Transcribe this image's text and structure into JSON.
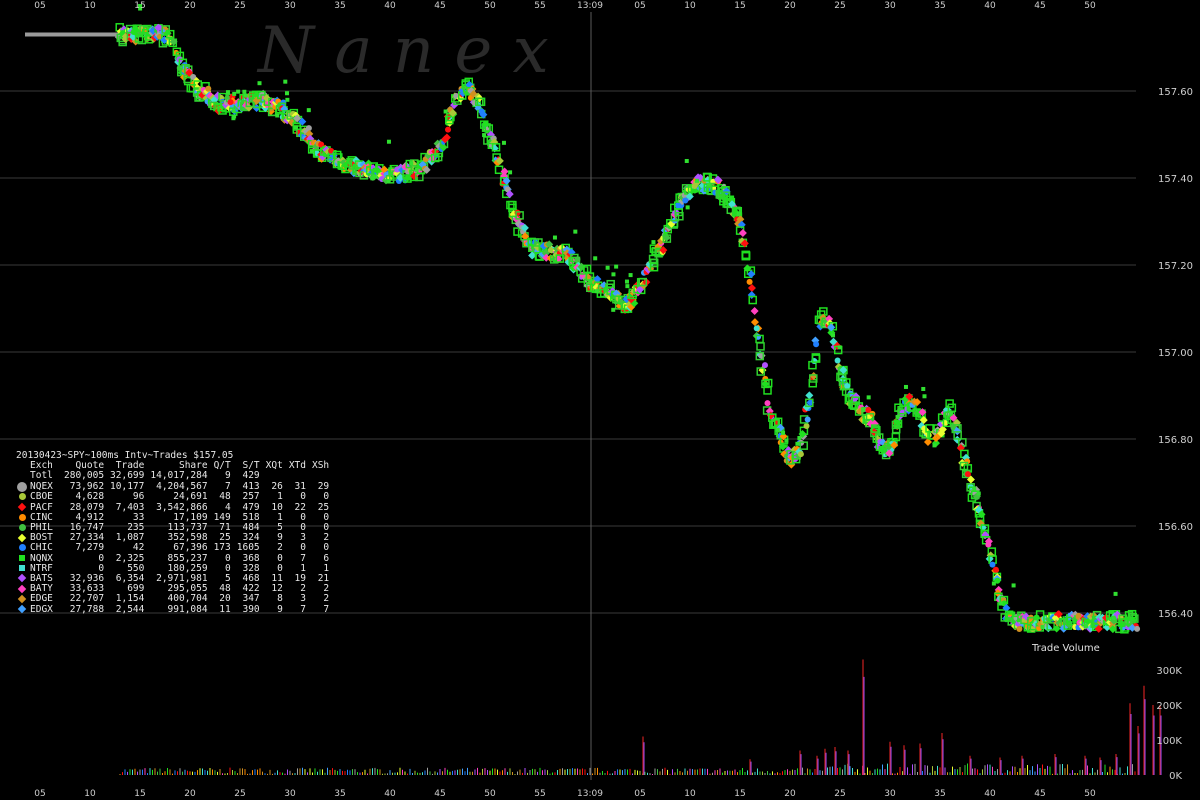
{
  "watermark": "N a n e x",
  "volume_label": "Trade Volume",
  "legend": {
    "title": "20130423~SPY~100ms Intv~Trades $157.05",
    "headers": [
      "Exch",
      "Quote",
      "Trade",
      "Share",
      "Q/T",
      "S/T",
      "XQt",
      "XTd",
      "XSh"
    ],
    "rows": [
      {
        "exch": "Totl",
        "quote": "280,005",
        "trade": "32,699",
        "share": "14,017,284",
        "qt": "9",
        "st": "429",
        "xqt": "",
        "xtd": "",
        "xsh": "",
        "color": "",
        "marker": "none"
      },
      {
        "exch": "NQEX",
        "quote": "73,962",
        "trade": "10,177",
        "share": "4,204,567",
        "qt": "7",
        "st": "413",
        "xqt": "26",
        "xtd": "31",
        "xsh": "29",
        "color": "#a0a0a0",
        "marker": "bigdot"
      },
      {
        "exch": "CBOE",
        "quote": "4,628",
        "trade": "96",
        "share": "24,691",
        "qt": "48",
        "st": "257",
        "xqt": "1",
        "xtd": "0",
        "xsh": "0",
        "color": "#a8c838",
        "marker": "dot"
      },
      {
        "exch": "PACF",
        "quote": "28,079",
        "trade": "7,403",
        "share": "3,542,866",
        "qt": "4",
        "st": "479",
        "xqt": "10",
        "xtd": "22",
        "xsh": "25",
        "color": "#ff1010",
        "marker": "dia"
      },
      {
        "exch": "CINC",
        "quote": "4,912",
        "trade": "33",
        "share": "17,109",
        "qt": "149",
        "st": "518",
        "xqt": "1",
        "xtd": "0",
        "xsh": "0",
        "color": "#ff8c00",
        "marker": "dot"
      },
      {
        "exch": "PHIL",
        "quote": "16,747",
        "trade": "235",
        "share": "113,737",
        "qt": "71",
        "st": "484",
        "xqt": "5",
        "xtd": "0",
        "xsh": "0",
        "color": "#40c040",
        "marker": "dot"
      },
      {
        "exch": "BOST",
        "quote": "27,334",
        "trade": "1,087",
        "share": "352,598",
        "qt": "25",
        "st": "324",
        "xqt": "9",
        "xtd": "3",
        "xsh": "2",
        "color": "#e8ff30",
        "marker": "dia"
      },
      {
        "exch": "CHIC",
        "quote": "7,279",
        "trade": "42",
        "share": "67,396",
        "qt": "173",
        "st": "1605",
        "xqt": "2",
        "xtd": "0",
        "xsh": "0",
        "color": "#2080ff",
        "marker": "dot"
      },
      {
        "exch": "NQNX",
        "quote": "0",
        "trade": "2,325",
        "share": "855,237",
        "qt": "0",
        "st": "368",
        "xqt": "0",
        "xtd": "7",
        "xsh": "6",
        "color": "#20e020",
        "marker": "sq"
      },
      {
        "exch": "NTRF",
        "quote": "0",
        "trade": "550",
        "share": "180,259",
        "qt": "0",
        "st": "328",
        "xqt": "0",
        "xtd": "1",
        "xsh": "1",
        "color": "#40e0d0",
        "marker": "sq"
      },
      {
        "exch": "BATS",
        "quote": "32,936",
        "trade": "6,354",
        "share": "2,971,981",
        "qt": "5",
        "st": "468",
        "xqt": "11",
        "xtd": "19",
        "xsh": "21",
        "color": "#b050ff",
        "marker": "dia"
      },
      {
        "exch": "BATY",
        "quote": "33,633",
        "trade": "699",
        "share": "295,055",
        "qt": "48",
        "st": "422",
        "xqt": "12",
        "xtd": "2",
        "xsh": "2",
        "color": "#ff40c0",
        "marker": "dia"
      },
      {
        "exch": "EDGE",
        "quote": "22,707",
        "trade": "1,154",
        "share": "400,704",
        "qt": "20",
        "st": "347",
        "xqt": "8",
        "xtd": "3",
        "xsh": "2",
        "color": "#d09020",
        "marker": "dia"
      },
      {
        "exch": "EDGX",
        "quote": "27,788",
        "trade": "2,544",
        "share": "991,084",
        "qt": "11",
        "st": "390",
        "xqt": "9",
        "xtd": "7",
        "xsh": "7",
        "color": "#40a0ff",
        "marker": "dia"
      }
    ]
  },
  "chart_data": {
    "type": "scatter",
    "x_ticks": [
      "05",
      "10",
      "15",
      "20",
      "25",
      "30",
      "35",
      "40",
      "45",
      "50",
      "55",
      "13:09",
      "05",
      "10",
      "15",
      "20",
      "25",
      "30",
      "35",
      "40",
      "45",
      "50"
    ],
    "price_ticks": [
      "157.60",
      "157.40",
      "157.20",
      "157.00",
      "156.80",
      "156.60",
      "156.40"
    ],
    "price_tick_values": [
      157.6,
      157.4,
      157.2,
      157.0,
      156.8,
      156.6,
      156.4
    ],
    "volume_ticks": [
      "300K",
      "200K",
      "100K",
      "0K"
    ],
    "volume_tick_values": [
      300000,
      200000,
      100000,
      0
    ],
    "ylim_price": [
      156.34,
      157.74
    ],
    "ylim_volume": [
      0,
      340000
    ],
    "price_path_x_seconds": [
      3,
      9,
      12,
      13,
      14,
      16,
      18,
      20,
      22,
      24,
      26,
      28,
      30,
      32,
      34,
      36,
      38,
      40,
      41,
      42,
      43,
      44,
      45,
      46,
      47,
      49,
      51,
      53,
      55,
      57,
      58,
      59,
      60,
      62,
      64,
      66,
      68,
      70,
      71,
      72,
      73,
      74,
      75,
      76,
      77,
      78,
      79,
      80,
      81,
      82,
      83,
      84,
      85,
      86,
      87,
      88,
      89,
      90,
      91,
      92,
      93,
      94,
      95,
      96,
      97,
      98,
      100,
      102,
      103,
      104,
      105,
      106,
      107,
      108,
      110,
      111,
      112
    ],
    "price_path_y": [
      157.73,
      157.73,
      157.73,
      157.72,
      157.66,
      157.6,
      157.57,
      157.57,
      157.58,
      157.56,
      157.52,
      157.46,
      157.44,
      157.42,
      157.41,
      157.41,
      157.42,
      157.47,
      157.54,
      157.6,
      157.61,
      157.56,
      157.49,
      157.44,
      157.34,
      157.24,
      157.23,
      157.22,
      157.16,
      157.14,
      157.11,
      157.12,
      157.15,
      157.24,
      157.34,
      157.39,
      157.38,
      157.3,
      157.17,
      157.0,
      156.87,
      156.82,
      156.75,
      156.77,
      156.9,
      157.08,
      157.06,
      156.96,
      156.9,
      156.86,
      156.85,
      156.79,
      156.77,
      156.86,
      156.89,
      156.85,
      156.8,
      156.82,
      156.87,
      156.79,
      156.7,
      156.63,
      156.55,
      156.43,
      156.38,
      156.38,
      156.38,
      156.38,
      156.38,
      156.38,
      156.38,
      156.38,
      156.38,
      156.38,
      156.38,
      156.38,
      156.38
    ],
    "volume_spikes": [
      {
        "x": 82.3,
        "v": 330000
      },
      {
        "x": 110.4,
        "v": 255000
      },
      {
        "x": 109.0,
        "v": 205000
      },
      {
        "x": 111.3,
        "v": 200000
      },
      {
        "x": 112.0,
        "v": 200000
      },
      {
        "x": 90.2,
        "v": 120000
      },
      {
        "x": 60.3,
        "v": 110000
      },
      {
        "x": 109.8,
        "v": 140000
      },
      {
        "x": 85.0,
        "v": 95000
      },
      {
        "x": 88.0,
        "v": 90000
      },
      {
        "x": 86.4,
        "v": 85000
      },
      {
        "x": 79.5,
        "v": 80000
      },
      {
        "x": 78.5,
        "v": 75000
      },
      {
        "x": 80.8,
        "v": 70000
      },
      {
        "x": 76.0,
        "v": 70000
      },
      {
        "x": 77.7,
        "v": 55000
      },
      {
        "x": 101.5,
        "v": 60000
      },
      {
        "x": 104.5,
        "v": 55000
      },
      {
        "x": 106.0,
        "v": 50000
      },
      {
        "x": 107.6,
        "v": 60000
      },
      {
        "x": 98.2,
        "v": 55000
      },
      {
        "x": 96.0,
        "v": 50000
      },
      {
        "x": 93.0,
        "v": 55000
      },
      {
        "x": 71.0,
        "v": 45000
      }
    ]
  }
}
